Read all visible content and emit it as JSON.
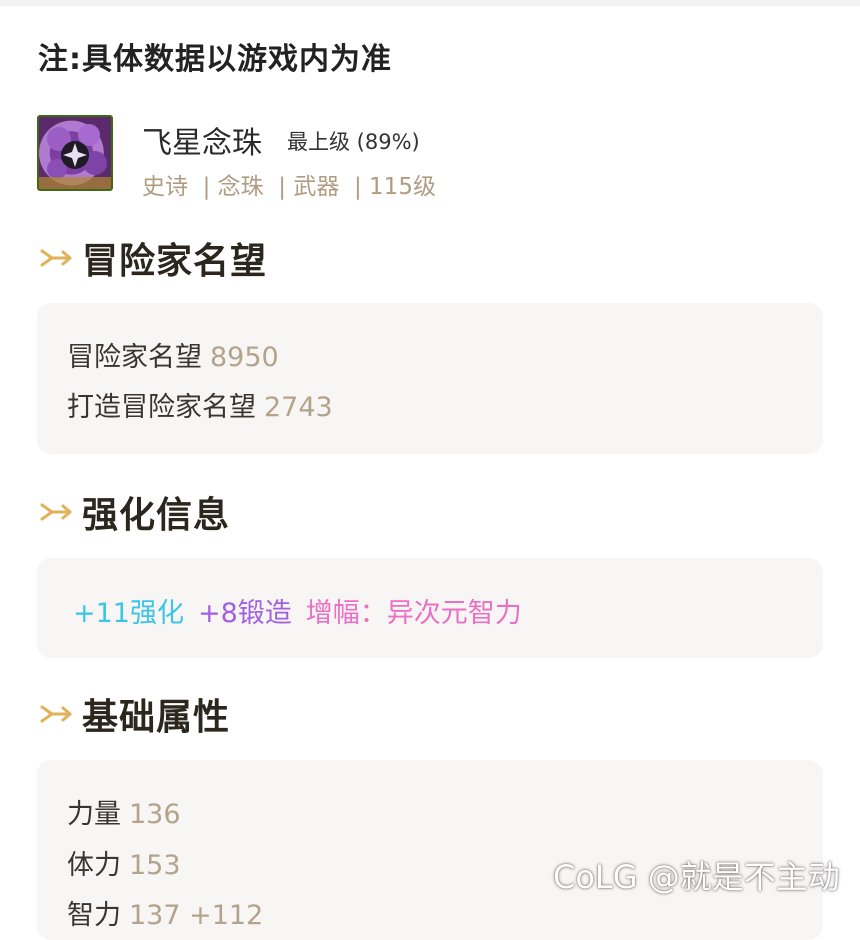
{
  "note": "注:具体数据以游戏内为准",
  "item": {
    "icon": "prayer-beads-icon",
    "name": "飞星念珠",
    "grade": "最上级 (89%)",
    "meta": "史诗  | 念珠  | 武器  | 115级"
  },
  "sections": {
    "reputation": {
      "title": "冒险家名望",
      "rows": [
        {
          "label": "冒险家名望",
          "value": "8950"
        },
        {
          "label": "打造冒险家名望",
          "value": "2743"
        }
      ]
    },
    "enhancement": {
      "title": "强化信息",
      "reinforce": "+11强化",
      "forge": "+8锻造",
      "amplify": "增幅：异次元智力"
    },
    "base_stats": {
      "title": "基础属性",
      "rows": [
        {
          "label": "力量",
          "value": "136"
        },
        {
          "label": "体力",
          "value": "153"
        },
        {
          "label": "智力",
          "value": "137 +112"
        }
      ]
    }
  },
  "watermark": "CoLG @就是不主动",
  "colors": {
    "accent_arrow": "#e0b25a",
    "reinforce": "#3bc5e6",
    "forge": "#a25fe0",
    "amplify": "#ec6fc6"
  }
}
